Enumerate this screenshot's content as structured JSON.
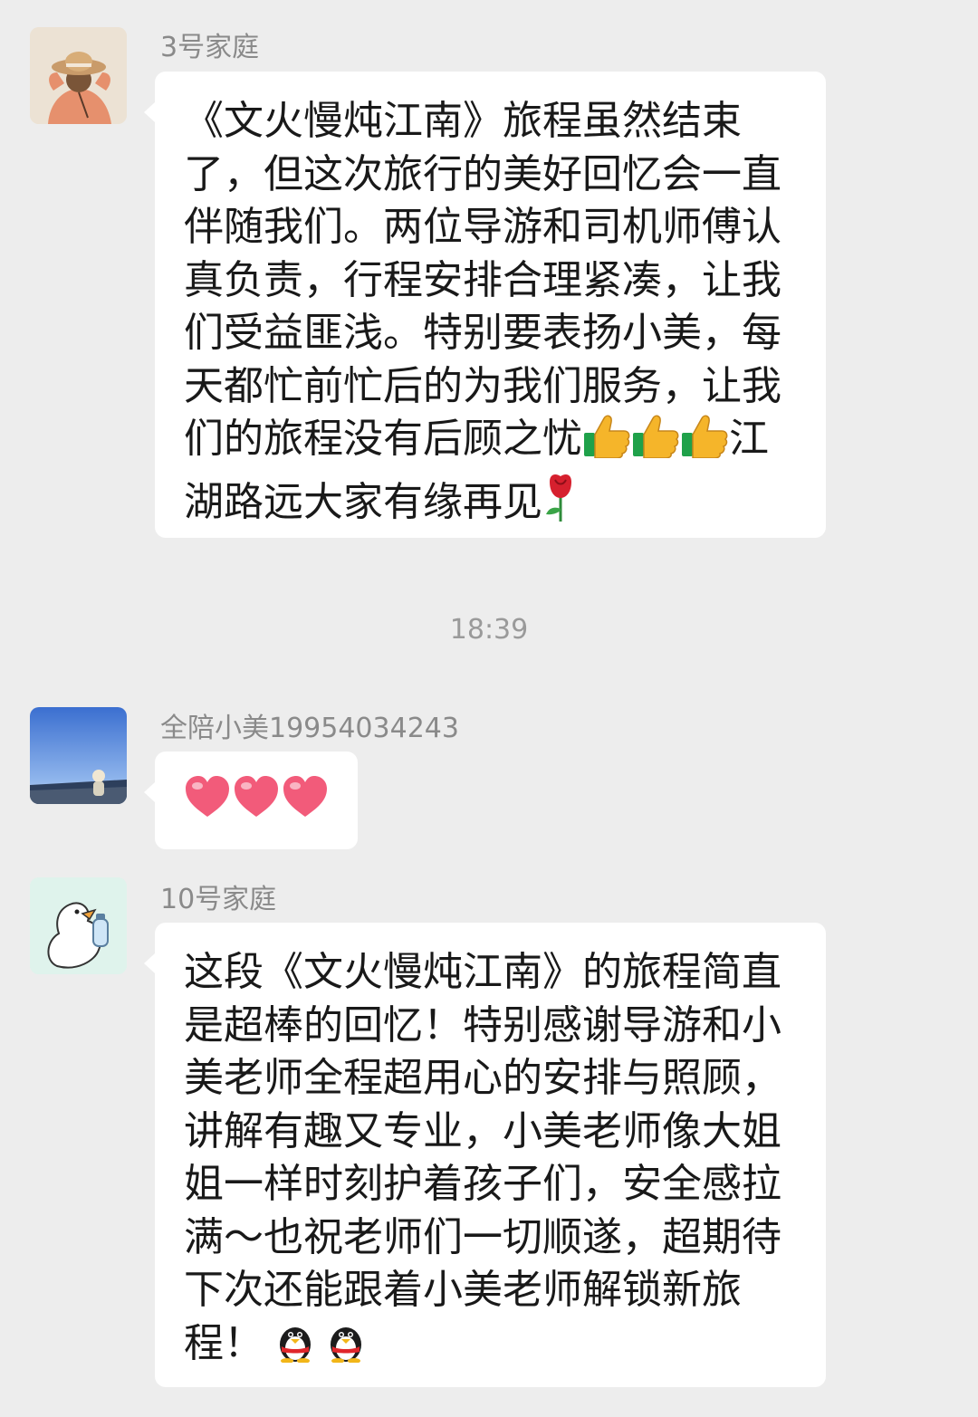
{
  "messages": [
    {
      "sender": "3号家庭",
      "text": "《文火慢炖江南》旅程虽然结束了，但这次旅行的美好回忆会一直伴随我们。两位导游和司机师傅认真负责，行程安排合理紧凑，让我们受益匪浅。特别要表扬小美，每天都忙前忙后的为我们服务，让我们的旅程没有后顾之忧",
      "text_after_thumbs": "江湖路远大家有缘再见",
      "emojis": [
        "thumbs-up",
        "thumbs-up",
        "thumbs-up",
        "rose"
      ]
    },
    {
      "sender": "全陪小美19954034243",
      "emojis": [
        "heart",
        "heart",
        "heart"
      ]
    },
    {
      "sender": "10号家庭",
      "text": "这段《文火慢炖江南》的旅程简直是超棒的回忆！特别感谢导游和小美老师全程超用心的安排与照顾，讲解有趣又专业，小美老师像大姐姐一样时刻护着孩子们，安全感拉满～也祝老师们一切顺遂，超期待下次还能跟着小美老师解锁新旅程！",
      "emojis": [
        "penguin",
        "penguin"
      ]
    }
  ],
  "timestamp": "18:39",
  "colors": {
    "background": "#ededed",
    "bubble": "#ffffff",
    "sender_name": "#8a8a8a",
    "message_text": "#191919",
    "timestamp": "#9a9a9a"
  }
}
